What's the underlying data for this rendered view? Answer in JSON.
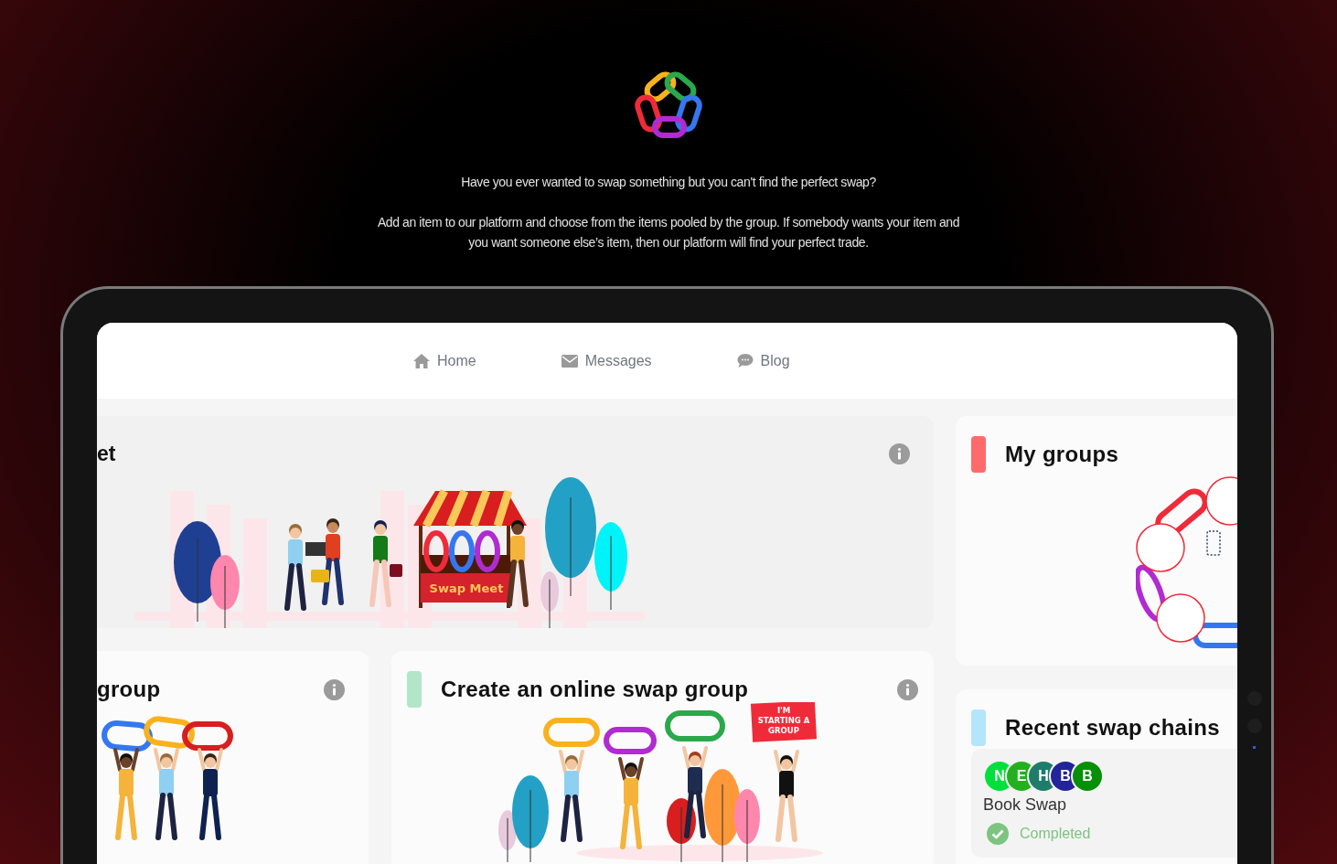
{
  "intro": {
    "question": "Have you ever wanted to swap something but you can't find the perfect swap?",
    "description": "Add an item to our platform and choose from the items pooled by the group. If somebody wants your item and you want someone else’s item, then our platform will find your perfect trade."
  },
  "nav": [
    {
      "kind": "home",
      "label": "Home"
    },
    {
      "kind": "mail",
      "label": "Messages"
    },
    {
      "kind": "chat",
      "label": "Blog"
    }
  ],
  "market_card": {
    "title": "et",
    "sign": "Swap Meet"
  },
  "group_cards": [
    {
      "title": "group"
    },
    {
      "title": "Create an online swap group",
      "color": "#b3e5c9",
      "sign_lines": [
        "I'M",
        "STARTING A",
        "GROUP"
      ]
    }
  ],
  "my_groups": {
    "title": "My groups",
    "color": "#ff6b6b"
  },
  "recent_chains": {
    "title": "Recent swap chains",
    "color": "#b3e5fc",
    "chains": [
      {
        "members": [
          {
            "initial": "N",
            "color": "#00e03c"
          },
          {
            "initial": "E",
            "color": "#22b01e"
          },
          {
            "initial": "H",
            "color": "#1e7d6a"
          },
          {
            "initial": "B",
            "color": "#23239a"
          },
          {
            "initial": "B",
            "color": "#078f07"
          }
        ],
        "name": "Book Swap",
        "status": "Completed"
      }
    ]
  }
}
